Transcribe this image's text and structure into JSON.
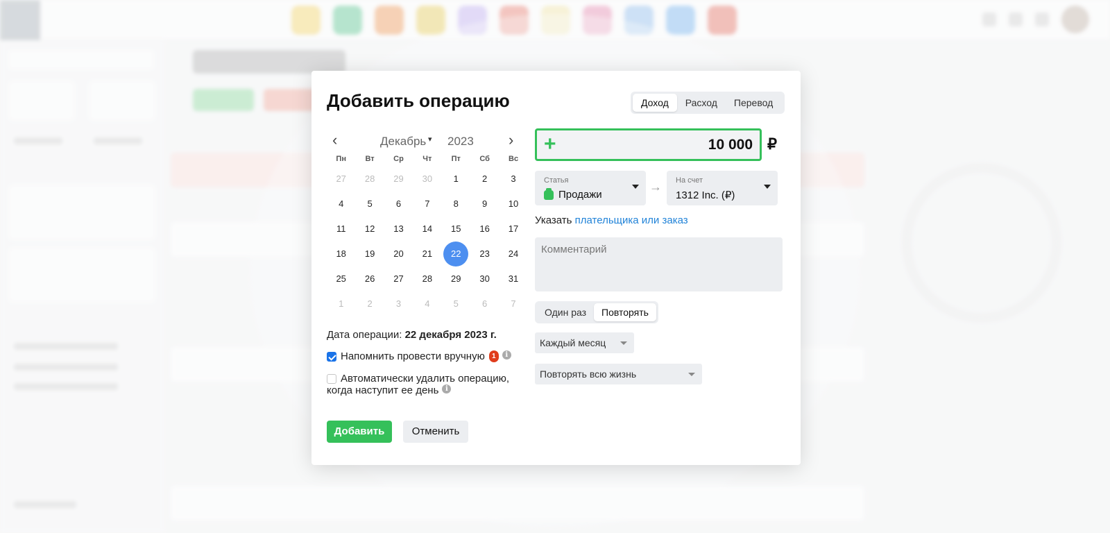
{
  "modal": {
    "title": "Добавить операцию",
    "type_tabs": [
      "Доход",
      "Расход",
      "Перевод"
    ],
    "active_type": "Доход"
  },
  "calendar": {
    "month": "Декабрь",
    "year": "2023",
    "weekdays": [
      "Пн",
      "Вт",
      "Ср",
      "Чт",
      "Пт",
      "Сб",
      "Вс"
    ],
    "weeks": [
      [
        "27",
        "28",
        "29",
        "30",
        "1",
        "2",
        "3"
      ],
      [
        "4",
        "5",
        "6",
        "7",
        "8",
        "9",
        "10"
      ],
      [
        "11",
        "12",
        "13",
        "14",
        "15",
        "16",
        "17"
      ],
      [
        "18",
        "19",
        "20",
        "21",
        "22",
        "23",
        "24"
      ],
      [
        "25",
        "26",
        "27",
        "28",
        "29",
        "30",
        "31"
      ],
      [
        "1",
        "2",
        "3",
        "4",
        "5",
        "6",
        "7"
      ]
    ],
    "selected_day": "22"
  },
  "op_date": {
    "label": "Дата операции:",
    "value": "22 декабря 2023 г."
  },
  "remind": {
    "label": "Напомнить провести вручную",
    "checked": true,
    "badge": "1"
  },
  "auto_delete": {
    "label": "Автоматически удалить операцию,",
    "label2": "когда наступит ее день",
    "checked": false
  },
  "amount": {
    "value": "10 000",
    "currency": "₽",
    "sign": "+"
  },
  "article": {
    "label": "Статья",
    "value": "Продажи"
  },
  "account": {
    "label": "На счет",
    "value": "1312 Inc. (₽)"
  },
  "payer": {
    "prefix": "Указать",
    "link": "плательщика или заказ"
  },
  "comment": {
    "placeholder": "Комментарий",
    "value": ""
  },
  "repeat_tabs": [
    "Один раз",
    "Повторять"
  ],
  "active_repeat": "Повторять",
  "frequency": "Каждый месяц",
  "duration": "Повторять всю жизнь",
  "buttons": {
    "add": "Добавить",
    "cancel": "Отменить"
  },
  "colors": {
    "accent_green": "#35c05a",
    "selected_day_blue": "#4d8ff0",
    "link_blue": "#2183d8",
    "badge_red": "#e03c1c"
  }
}
